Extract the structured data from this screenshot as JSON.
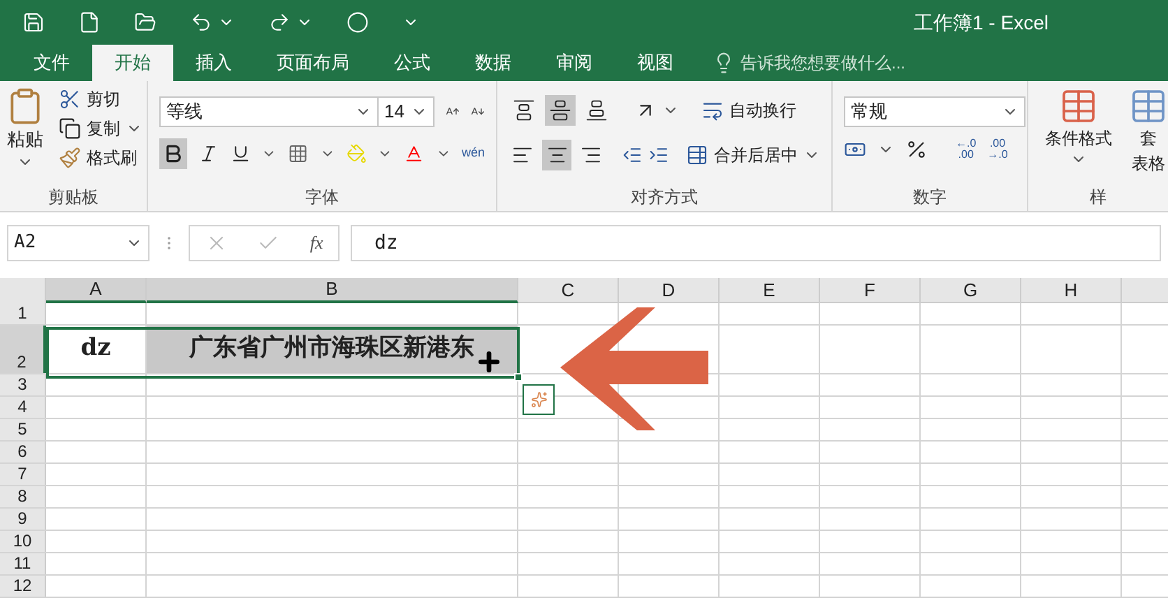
{
  "window": {
    "title": "工作簿1 - Excel"
  },
  "tabs": [
    {
      "label": "文件",
      "selected": false
    },
    {
      "label": "开始",
      "selected": true
    },
    {
      "label": "插入",
      "selected": false
    },
    {
      "label": "页面布局",
      "selected": false
    },
    {
      "label": "公式",
      "selected": false
    },
    {
      "label": "数据",
      "selected": false
    },
    {
      "label": "审阅",
      "selected": false
    },
    {
      "label": "视图",
      "selected": false
    }
  ],
  "tell_me": {
    "placeholder": "告诉我您想要做什么..."
  },
  "clipboard": {
    "label": "剪贴板",
    "paste": "粘贴",
    "cut": "剪切",
    "copy": "复制",
    "format_painter": "格式刷"
  },
  "font": {
    "label": "字体",
    "font_name": "等线",
    "font_size": "14",
    "bold_on": true,
    "phonetic": "wén"
  },
  "alignment": {
    "label": "对齐方式",
    "vertical_buttons": [
      {
        "kind": "top",
        "selected": false
      },
      {
        "kind": "middle",
        "selected": true
      },
      {
        "kind": "bottom",
        "selected": false
      }
    ],
    "horizontal_buttons": [
      {
        "kind": "left",
        "selected": false
      },
      {
        "kind": "center",
        "selected": true
      },
      {
        "kind": "right",
        "selected": false
      }
    ],
    "wrap_text": "自动换行",
    "merge_center": "合并后居中"
  },
  "number": {
    "label": "数字",
    "format": "常规",
    "decimal_increase": [
      "←.0",
      ".00"
    ],
    "decimal_decrease": [
      ".00",
      "→.0"
    ]
  },
  "styles": {
    "label": "样",
    "conditional_format": "条件格式",
    "table_format_1": "套",
    "table_format_2": "表格"
  },
  "formula_bar": {
    "name_box": "A2",
    "function_label": "fx",
    "value": "dz"
  },
  "grid": {
    "columns": [
      {
        "label": "A",
        "selected": true
      },
      {
        "label": "B",
        "selected": true
      },
      {
        "label": "C",
        "selected": false
      },
      {
        "label": "D",
        "selected": false
      },
      {
        "label": "E",
        "selected": false
      },
      {
        "label": "F",
        "selected": false
      },
      {
        "label": "G",
        "selected": false
      },
      {
        "label": "H",
        "selected": false
      }
    ],
    "rows": [
      {
        "label": "1",
        "selected": false,
        "cells": []
      },
      {
        "label": "2",
        "selected": true,
        "cells": [
          {
            "text": "dz",
            "selected": false
          },
          {
            "text": "广东省广州市海珠区新港东",
            "selected": true
          }
        ]
      },
      {
        "label": "3",
        "selected": false,
        "cells": []
      },
      {
        "label": "4",
        "selected": false,
        "cells": []
      },
      {
        "label": "5",
        "selected": false,
        "cells": []
      },
      {
        "label": "6",
        "selected": false,
        "cells": []
      },
      {
        "label": "7",
        "selected": false,
        "cells": []
      },
      {
        "label": "8",
        "selected": false,
        "cells": []
      },
      {
        "label": "9",
        "selected": false,
        "cells": []
      },
      {
        "label": "10",
        "selected": false,
        "cells": []
      },
      {
        "label": "11",
        "selected": false,
        "cells": []
      },
      {
        "label": "12",
        "selected": false,
        "cells": []
      }
    ]
  }
}
